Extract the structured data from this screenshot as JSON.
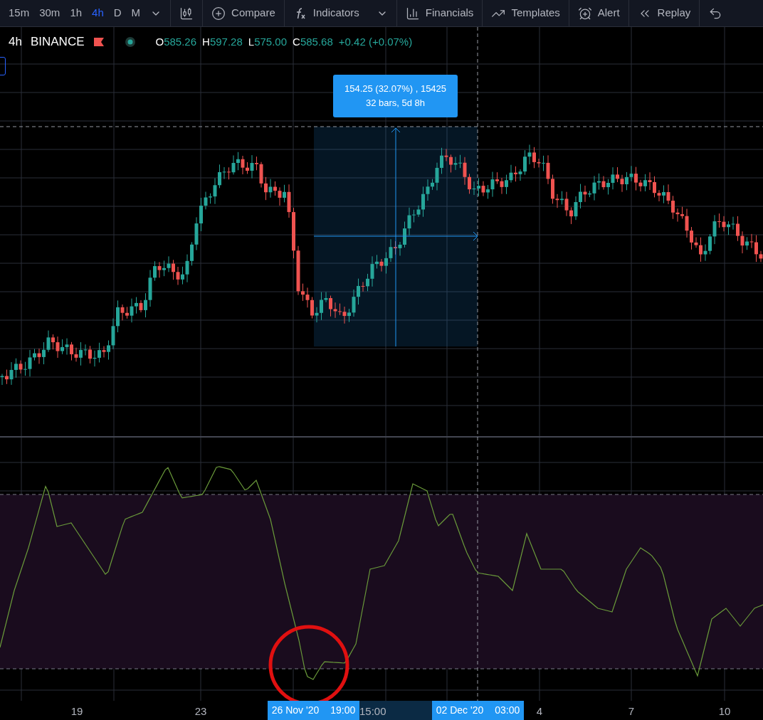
{
  "toolbar": {
    "intervals": [
      {
        "label": "15m",
        "selected": false
      },
      {
        "label": "30m",
        "selected": false
      },
      {
        "label": "1h",
        "selected": false
      },
      {
        "label": "4h",
        "selected": true
      },
      {
        "label": "D",
        "selected": false
      },
      {
        "label": "M",
        "selected": false
      }
    ],
    "buttons": [
      {
        "kind": "compare",
        "label": "Compare"
      },
      {
        "kind": "indicators",
        "label": "Indicators"
      },
      {
        "kind": "financials",
        "label": "Financials"
      },
      {
        "kind": "templates",
        "label": "Templates"
      },
      {
        "kind": "alert",
        "label": "Alert"
      },
      {
        "kind": "replay",
        "label": "Replay"
      }
    ]
  },
  "legend": {
    "interval": "4h",
    "exchange": "BINANCE",
    "ohlc": [
      {
        "key": "O",
        "value": "585.26"
      },
      {
        "key": "H",
        "value": "597.28"
      },
      {
        "key": "L",
        "value": "575.00"
      },
      {
        "key": "C",
        "value": "585.68"
      }
    ],
    "change": "+0.42 (+0.07%)"
  },
  "measure": {
    "line_1": "154.25 (32.07%) , 15425",
    "line_2": "32 bars, 5d 8h"
  },
  "time_axis": [
    {
      "kind": "tick",
      "text": "19"
    },
    {
      "kind": "tick",
      "text": "23"
    },
    {
      "kind": "highlight",
      "date": "26 Nov '20",
      "time": "19:00"
    },
    {
      "kind": "range",
      "text": "15:00"
    },
    {
      "kind": "highlight",
      "date": "02 Dec '20",
      "time": "03:00"
    },
    {
      "kind": "tick",
      "text": "4"
    },
    {
      "kind": "tick",
      "text": "7"
    },
    {
      "kind": "tick",
      "text": "10"
    }
  ]
}
